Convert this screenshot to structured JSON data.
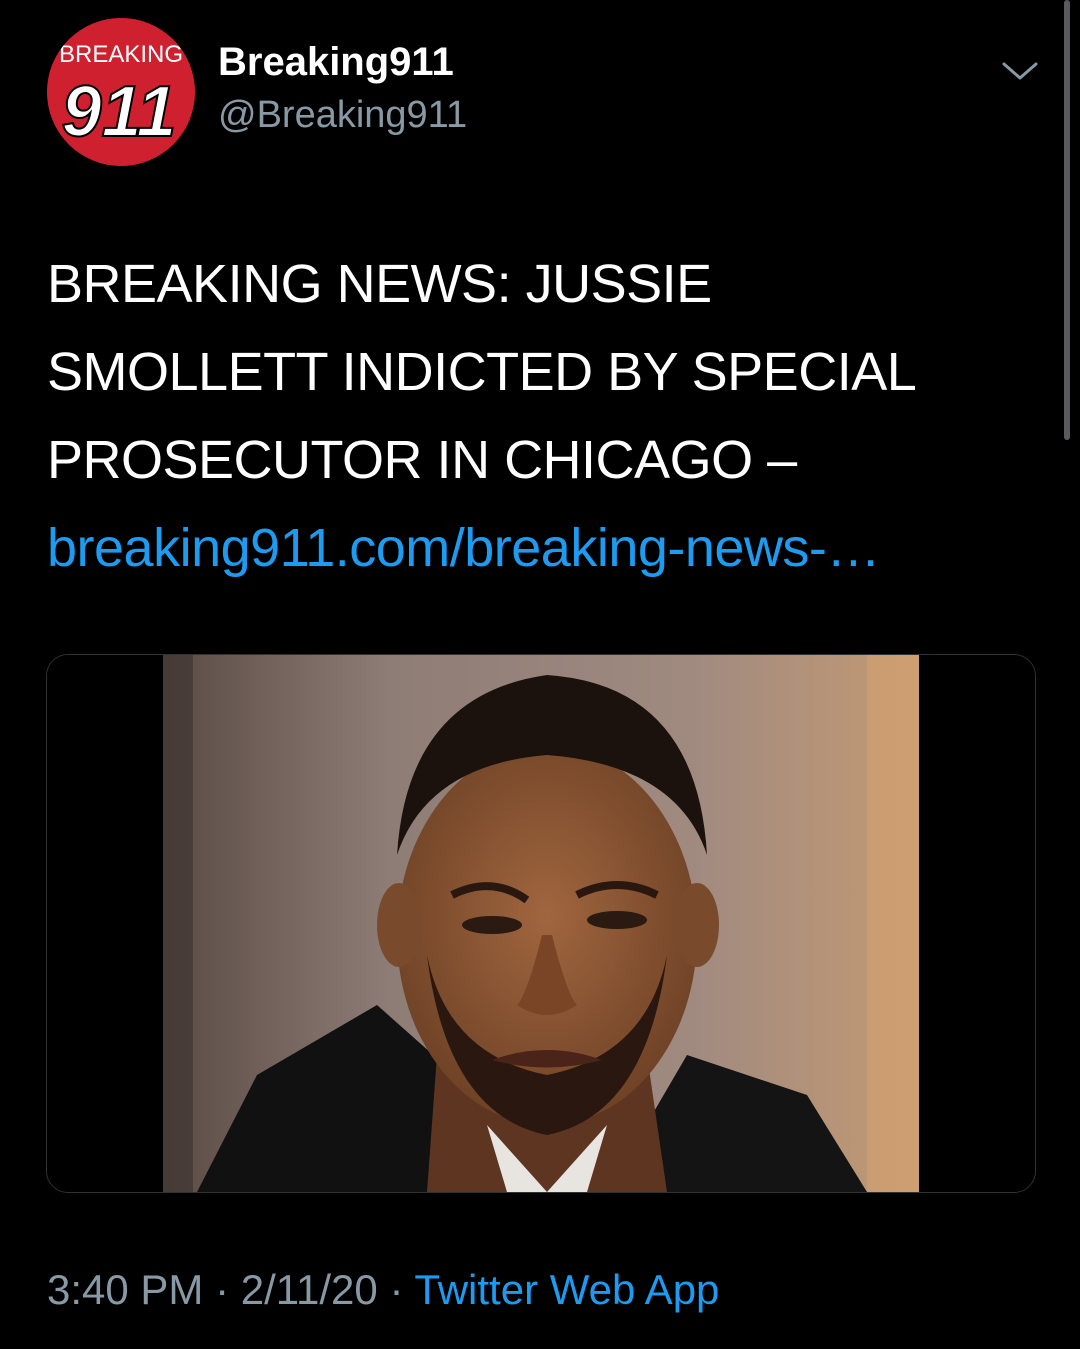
{
  "tweet": {
    "avatar": {
      "logo_top_text": "BREAKING",
      "logo_number": "911",
      "color": "#cf2030"
    },
    "author_name": "Breaking911",
    "author_handle": "@Breaking911",
    "text_lines": [
      "BREAKING NEWS: JUSSIE",
      "SMOLLETT INDICTED BY SPECIAL",
      "PROSECUTOR IN CHICAGO –"
    ],
    "link": "breaking911.com/breaking-news-…",
    "menu_icon": "chevron-down-icon",
    "time": "3:40 PM",
    "separator": "·",
    "date": "2/11/20",
    "source": "Twitter Web App",
    "link_color": "#1d9bf0",
    "muted_color": "#8899a6"
  }
}
